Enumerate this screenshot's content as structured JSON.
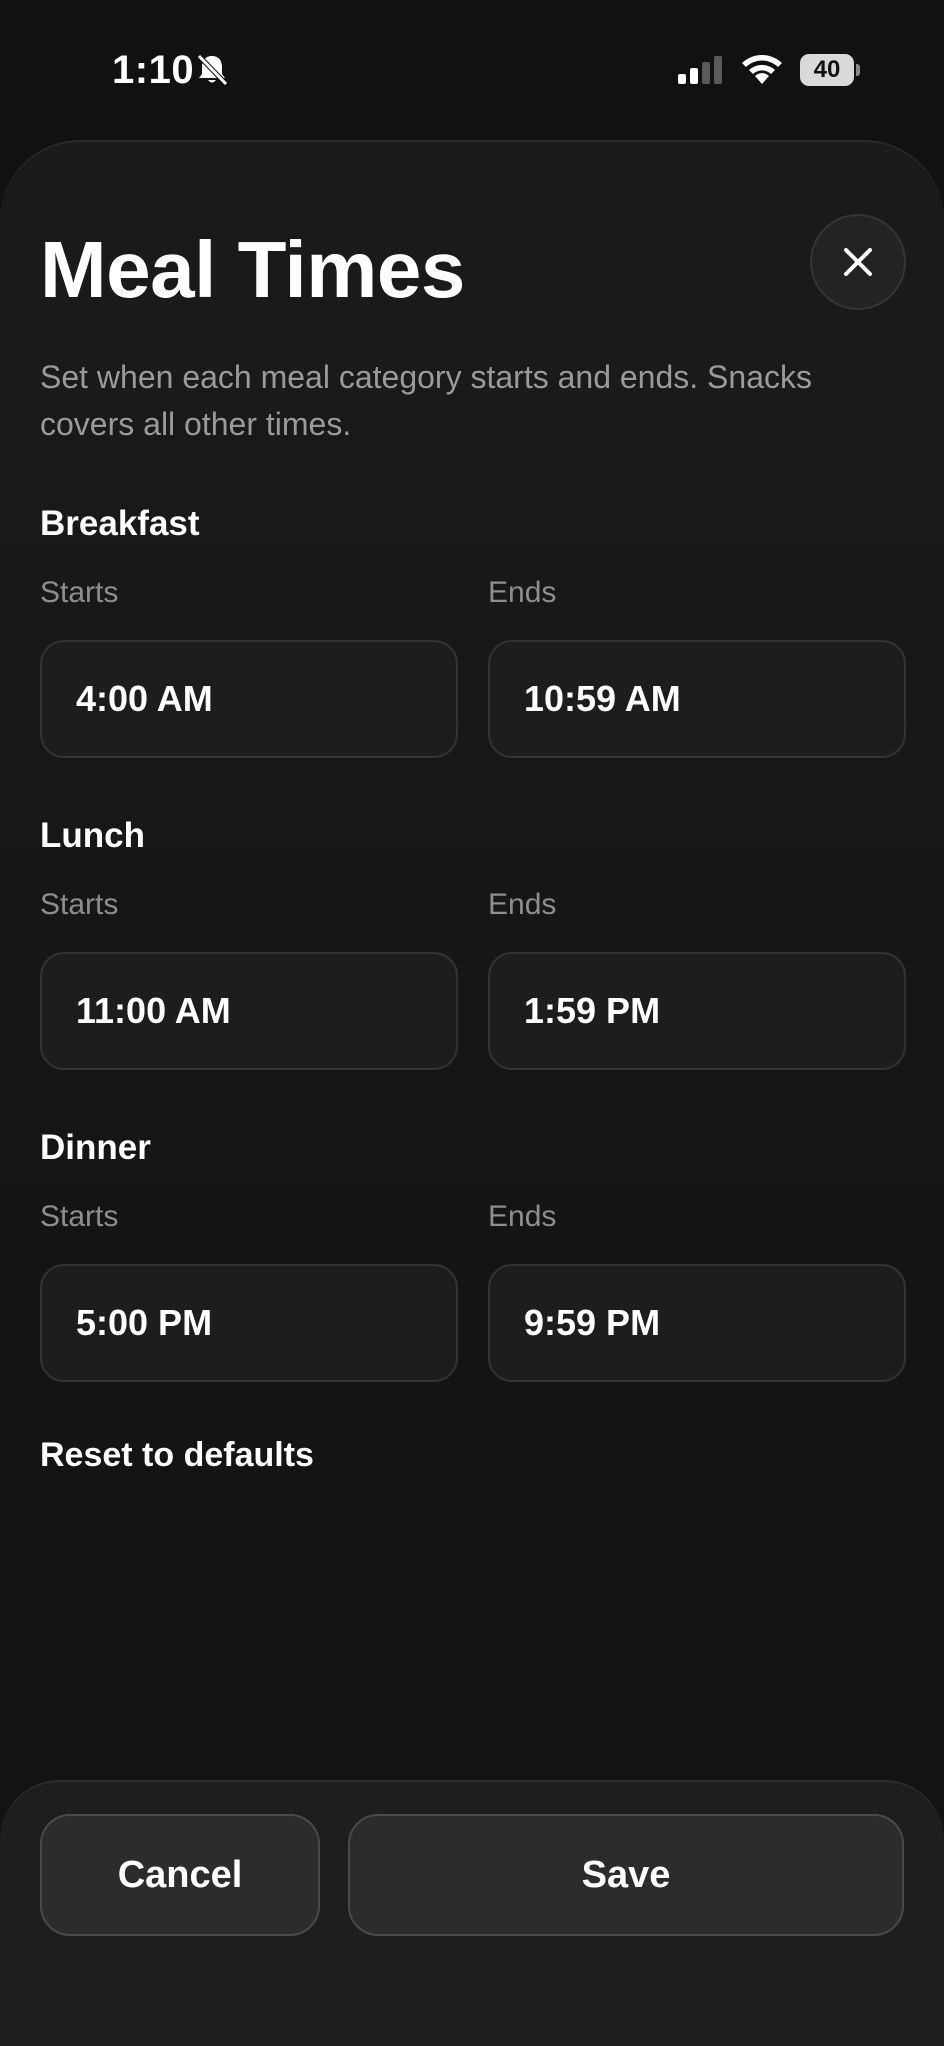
{
  "status_bar": {
    "time": "1:10",
    "battery": "40",
    "icons": [
      "bell-slash-icon",
      "cellular-signal-icon",
      "wifi-icon",
      "battery-icon"
    ]
  },
  "sheet": {
    "title": "Meal Times",
    "close_icon": "close-icon",
    "subtitle": "Set when each meal category starts and ends. Snacks covers all other times.",
    "meals": [
      {
        "name": "Breakfast",
        "starts_label": "Starts",
        "ends_label": "Ends",
        "start": "4:00 AM",
        "end": "10:59 AM"
      },
      {
        "name": "Lunch",
        "starts_label": "Starts",
        "ends_label": "Ends",
        "start": "11:00 AM",
        "end": "1:59 PM"
      },
      {
        "name": "Dinner",
        "starts_label": "Starts",
        "ends_label": "Ends",
        "start": "5:00 PM",
        "end": "9:59 PM"
      }
    ],
    "reset_label": "Reset to defaults"
  },
  "footer": {
    "cancel_label": "Cancel",
    "save_label": "Save"
  }
}
